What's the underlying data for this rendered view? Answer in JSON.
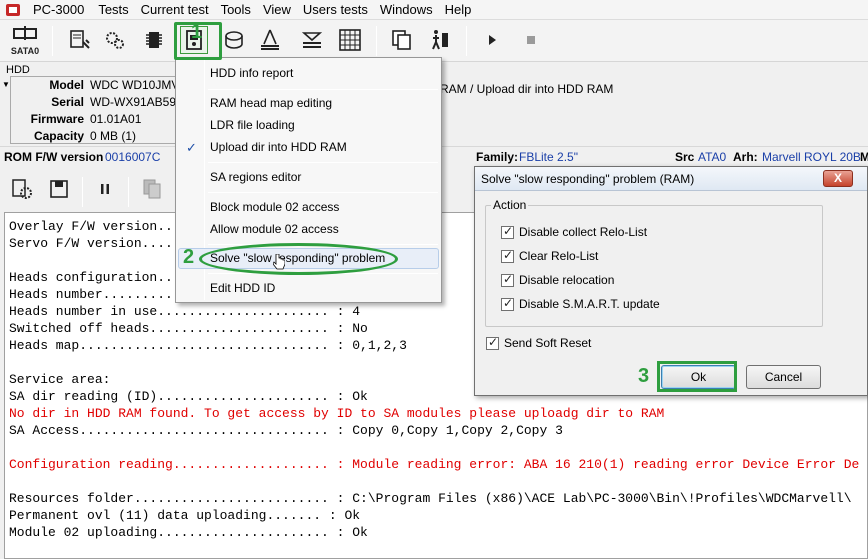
{
  "menubar": {
    "app_name": "PC-3000",
    "items": [
      "Tests",
      "Current test",
      "Tools",
      "View",
      "Users tests",
      "Windows",
      "Help"
    ]
  },
  "toolbar": {
    "sata_label": "SATA0"
  },
  "annotations": {
    "step1": "1",
    "step2": "2",
    "step3": "3",
    "color": "#2e9e3f"
  },
  "hdd": {
    "section_label": "HDD",
    "fields": [
      {
        "key": "Model",
        "value": "WDC WD10JMVW"
      },
      {
        "key": "Serial",
        "value": "WD-WX91AB596"
      },
      {
        "key": "Firmware",
        "value": "01.01A01"
      },
      {
        "key": "Capacity",
        "value": "0 MB (1)"
      }
    ],
    "status_text": "RAM / Upload dir into HDD RAM"
  },
  "rom": {
    "fw_label": "ROM F/W version",
    "fw_value": "0016007C",
    "family_label": "Family:",
    "family_value": "FBLite 2.5\"",
    "src_label": "Src",
    "src_value": "ATA0",
    "arh_label": "Arh:",
    "arh_value": "Marvell ROYL 20B",
    "m_label": "M"
  },
  "dropdown": {
    "items": [
      {
        "label": "HDD info report",
        "checked": false
      },
      {
        "label": "RAM head map editing",
        "checked": false
      },
      {
        "label": "LDR file loading",
        "checked": false
      },
      {
        "label": "Upload dir into HDD RAM",
        "checked": true
      },
      {
        "label": "SA regions editor",
        "checked": false
      },
      {
        "label": "Block module 02 access",
        "checked": false
      },
      {
        "label": "Allow module 02 access",
        "checked": false
      },
      {
        "label": "Solve \"slow responding\" problem",
        "checked": false
      },
      {
        "label": "Edit HDD ID",
        "checked": false
      }
    ],
    "check_glyph": "✓"
  },
  "dialog": {
    "title": "Solve \"slow responding\" problem (RAM)",
    "close_glyph": "X",
    "group_label": "Action",
    "options": [
      {
        "label": "Disable collect Relo-List",
        "checked": true
      },
      {
        "label": "Clear Relo-List",
        "checked": true
      },
      {
        "label": "Disable relocation",
        "checked": true
      },
      {
        "label": "Disable S.M.A.R.T. update",
        "checked": true
      }
    ],
    "send_soft_reset": {
      "label": "Send Soft Reset",
      "checked": true
    },
    "ok_label": "Ok",
    "cancel_label": "Cancel"
  },
  "log": {
    "lines": [
      {
        "text": "Overlay F/W version...",
        "error": false
      },
      {
        "text": "Servo F/W version....",
        "error": false
      },
      {
        "text": "",
        "error": false
      },
      {
        "text": "Heads configuration....",
        "error": false
      },
      {
        "text": "Heads number..........",
        "error": false
      },
      {
        "text": "Heads number in use...................... : 4",
        "error": false
      },
      {
        "text": "Switched off heads....................... : No",
        "error": false
      },
      {
        "text": "Heads map................................ : 0,1,2,3",
        "error": false
      },
      {
        "text": "",
        "error": false
      },
      {
        "text": "Service area:",
        "error": false
      },
      {
        "text": "SA dir reading (ID)...................... : Ok",
        "error": false
      },
      {
        "text": "No dir in HDD RAM found. To get access by ID to SA modules please uploadg dir to RAM",
        "error": true
      },
      {
        "text": "SA Access................................ : Copy 0,Copy 1,Copy 2,Copy 3",
        "error": false
      },
      {
        "text": "",
        "error": false
      },
      {
        "text": "Configuration reading.................... : Module reading error: ABA 16 210(1) reading error Device Error De",
        "error": true
      },
      {
        "text": "",
        "error": false
      },
      {
        "text": "Resources folder......................... : C:\\Program Files (x86)\\ACE Lab\\PC-3000\\Bin\\!Profiles\\WDCMarvell\\",
        "error": false
      },
      {
        "text": "Permanent ovl (11) data uploading....... : Ok",
        "error": false
      },
      {
        "text": "Module 02 uploading...................... : Ok",
        "error": false
      }
    ]
  }
}
